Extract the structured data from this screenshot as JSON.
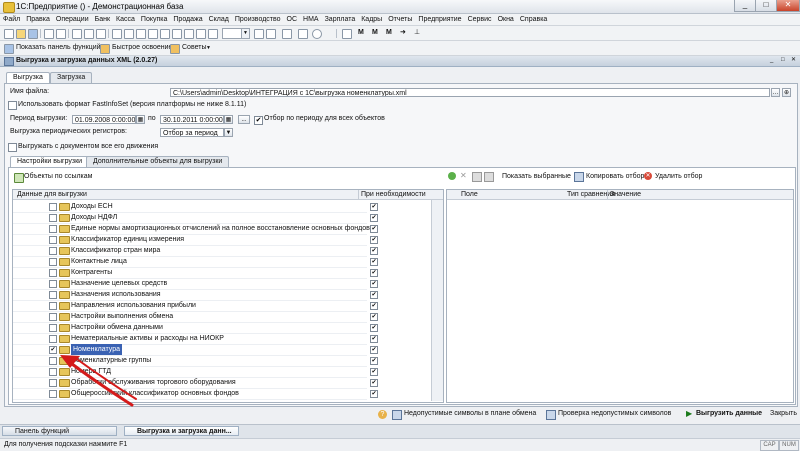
{
  "window": {
    "title": "1С:Предприятие () - Демонстрационная база",
    "controls": [
      "_",
      "□",
      "✕"
    ]
  },
  "menubar": {
    "items": [
      "Файл",
      "Правка",
      "Операции",
      "Банк",
      "Касса",
      "Покупка",
      "Продажа",
      "Склад",
      "Производство",
      "ОС",
      "НМА",
      "Зарплата",
      "Кадры",
      "Отчеты",
      "Предприятие",
      "Сервис",
      "Окна",
      "Справка"
    ]
  },
  "toolbar2": {
    "items": [
      "Показать панель функций",
      "Быстрое освоение",
      "Советы"
    ]
  },
  "form": {
    "title": "Выгрузка и загрузка данных XML (2.0.27)",
    "tabs": [
      "Выгрузка",
      "Загрузка"
    ],
    "file_label": "Имя файла:",
    "file_value": "C:\\Users\\admin\\Desktop\\ИНТЕГРАЦИЯ с 1С\\выгрузка номенклатуры.xml",
    "fastinfoset_label": "Использовать формат FastInfoSet (версия платформы не ниже 8.1.11)",
    "period_label": "Период выгрузки:",
    "period_from": "01.09.2008 0:00:00",
    "period_to_label": "по",
    "period_to": "30.10.2011 0:00:00",
    "period_btn": "...",
    "period_all_label": "Отбор по периоду для всех объектов",
    "registers_label": "Выгрузка периодических регистров:",
    "registers_value": "Отбор за период",
    "with_movements_label": "Выгружать с документом все его движения",
    "inner_tabs": [
      "Настройки выгрузки",
      "Дополнительные объекты для выгрузки"
    ],
    "by_links_label": "Объекты по ссылкам",
    "left_grid": {
      "col_data": "Данные для выгрузки",
      "col_need": "При необходимости",
      "rows": [
        {
          "label": "Доходы ЕСН",
          "checked": false,
          "need": true
        },
        {
          "label": "Доходы НДФЛ",
          "checked": false,
          "need": true
        },
        {
          "label": "Единые нормы амортизационных отчислений на полное восстановление основных фондов",
          "checked": false,
          "need": true
        },
        {
          "label": "Классификатор единиц измерения",
          "checked": false,
          "need": true
        },
        {
          "label": "Классификатор стран мира",
          "checked": false,
          "need": true
        },
        {
          "label": "Контактные лица",
          "checked": false,
          "need": true
        },
        {
          "label": "Контрагенты",
          "checked": false,
          "need": true
        },
        {
          "label": "Назначение целевых средств",
          "checked": false,
          "need": true
        },
        {
          "label": "Назначения использования",
          "checked": false,
          "need": true
        },
        {
          "label": "Направления использования прибыли",
          "checked": false,
          "need": true
        },
        {
          "label": "Настройки выполнения обмена",
          "checked": false,
          "need": true
        },
        {
          "label": "Настройки обмена данными",
          "checked": false,
          "need": true
        },
        {
          "label": "Нематериальные активы и расходы на НИОКР",
          "checked": false,
          "need": true
        },
        {
          "label": "Номенклатура",
          "checked": true,
          "need": true,
          "selected": true
        },
        {
          "label": "Номенклатурные группы",
          "checked": false,
          "need": true
        },
        {
          "label": "Номера ГТД",
          "checked": false,
          "need": true
        },
        {
          "label": "Обработки обслуживания торгового оборудования",
          "checked": false,
          "need": true
        },
        {
          "label": "Общероссийский классификатор основных фондов",
          "checked": false,
          "need": true
        }
      ]
    },
    "right_toolbar": {
      "show_selected": "Показать выбранные",
      "copy_filter": "Копировать отбор",
      "delete_filter": "Удалить отбор"
    },
    "right_grid": {
      "col_field": "Поле",
      "col_compare": "Тип сравнения",
      "col_value": "Значение"
    },
    "bottom": {
      "invalid_chars": "Недопустимые символы в плане обмена",
      "check_invalid": "Проверка недопустимых символов",
      "export": "Выгрузить данные",
      "close": "Закрыть"
    }
  },
  "taskbar": {
    "tasks": [
      "Панель функций",
      "Выгрузка и загрузка данн..."
    ]
  },
  "statusbar": {
    "hint": "Для получения подсказки нажмите F1",
    "indicators": [
      "CAP",
      "NUM"
    ]
  },
  "colors": {
    "selection": "#3a62b3",
    "arrow": "#d41a1a"
  }
}
